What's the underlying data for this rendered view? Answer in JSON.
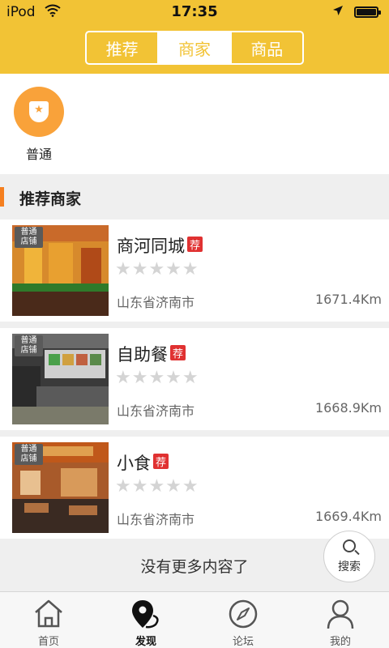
{
  "status": {
    "carrier": "iPod",
    "time": "17:35"
  },
  "tabs": [
    {
      "label": "推荐",
      "active": false
    },
    {
      "label": "商家",
      "active": true
    },
    {
      "label": "商品",
      "active": false
    }
  ],
  "category": {
    "label": "普通",
    "color": "#f9a23a"
  },
  "section": {
    "title": "推荐商家",
    "accent": "#f57f1f"
  },
  "shops": [
    {
      "tag": "普通店铺",
      "name": "商河同城",
      "badge": "荐",
      "rating": 0,
      "city": "山东省济南市",
      "distance": "1671.4Km"
    },
    {
      "tag": "普通店铺",
      "name": "自助餐",
      "badge": "荐",
      "rating": 0,
      "city": "山东省济南市",
      "distance": "1668.9Km"
    },
    {
      "tag": "普通店铺",
      "name": "小食",
      "badge": "荐",
      "rating": 0,
      "city": "山东省济南市",
      "distance": "1669.4Km"
    }
  ],
  "footer_note": "没有更多内容了",
  "search_button": {
    "label": "搜索",
    "icon": "search-icon"
  },
  "tabbar": [
    {
      "label": "首页",
      "icon": "home-icon",
      "active": false
    },
    {
      "label": "发现",
      "icon": "location-pin-icon",
      "active": true
    },
    {
      "label": "论坛",
      "icon": "compass-icon",
      "active": false
    },
    {
      "label": "我的",
      "icon": "user-icon",
      "active": false
    }
  ],
  "colors": {
    "header": "#f2c335",
    "badge": "#e03131"
  }
}
